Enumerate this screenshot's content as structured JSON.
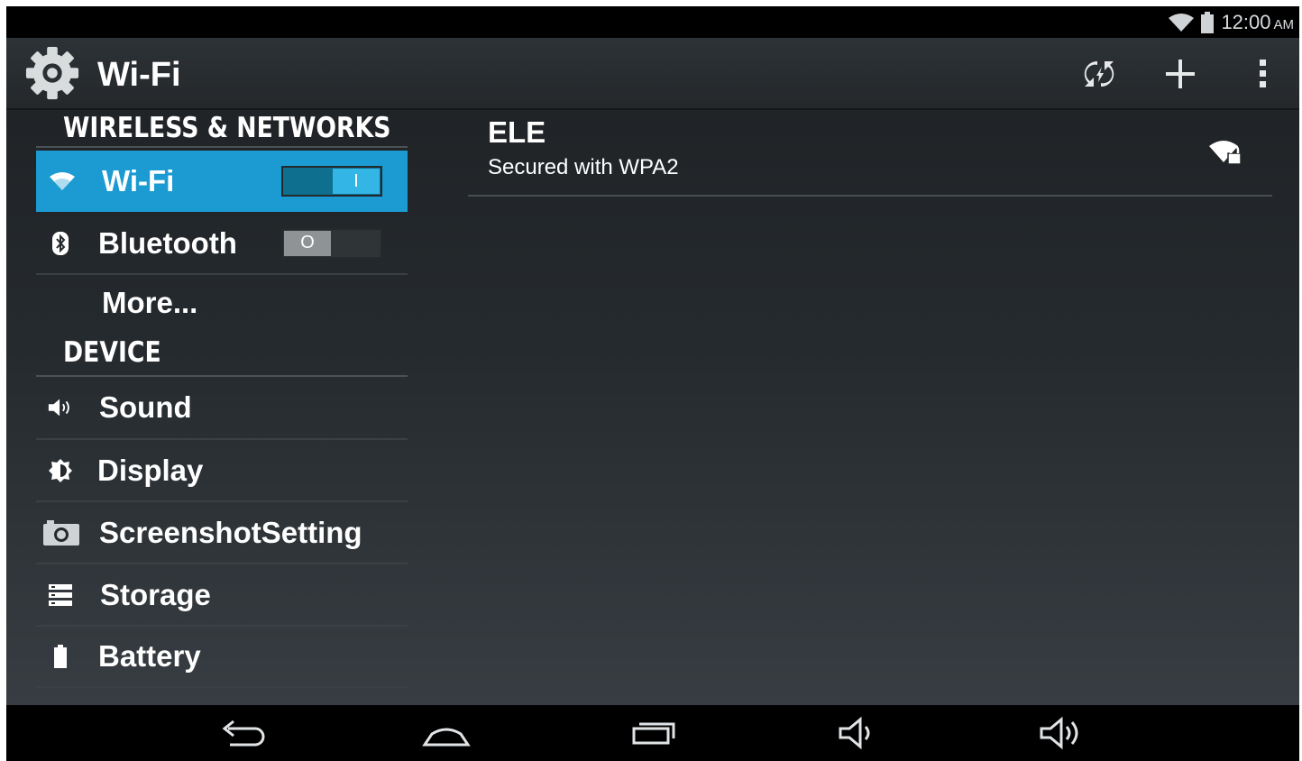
{
  "status_bar": {
    "time": "12:00",
    "ampm": "AM",
    "icons": [
      "wifi-signal-icon",
      "battery-icon"
    ]
  },
  "action_bar": {
    "title": "Wi-Fi",
    "app_icon": "settings-gear-icon",
    "actions": [
      "wps-icon",
      "add-network-icon",
      "overflow-menu-icon"
    ]
  },
  "sidebar": {
    "wireless_header": "WIRELESS & NETWORKS",
    "device_header": "DEVICE",
    "items": [
      {
        "label": "Wi-Fi",
        "icon": "wifi-icon",
        "toggle": "I",
        "toggle_on": true,
        "selected": true
      },
      {
        "label": "Bluetooth",
        "icon": "bluetooth-icon",
        "toggle": "O",
        "toggle_on": false
      },
      {
        "label": "More...",
        "icon": ""
      },
      {
        "label": "Sound",
        "icon": "sound-icon"
      },
      {
        "label": "Display",
        "icon": "display-brightness-icon"
      },
      {
        "label": "ScreenshotSetting",
        "icon": "camera-icon"
      },
      {
        "label": "Storage",
        "icon": "storage-icon"
      },
      {
        "label": "Battery",
        "icon": "battery-icon"
      }
    ]
  },
  "networks": [
    {
      "ssid": "ELE",
      "status": "Secured with WPA2",
      "icon": "wifi-lock-icon"
    }
  ],
  "nav_bar": {
    "buttons": [
      "back-icon",
      "home-icon",
      "recent-apps-icon",
      "volume-down-icon",
      "volume-up-icon"
    ]
  },
  "colors": {
    "accent": "#1b9bd2",
    "toggle_on": "#33b5e5",
    "background": "#24292c"
  }
}
